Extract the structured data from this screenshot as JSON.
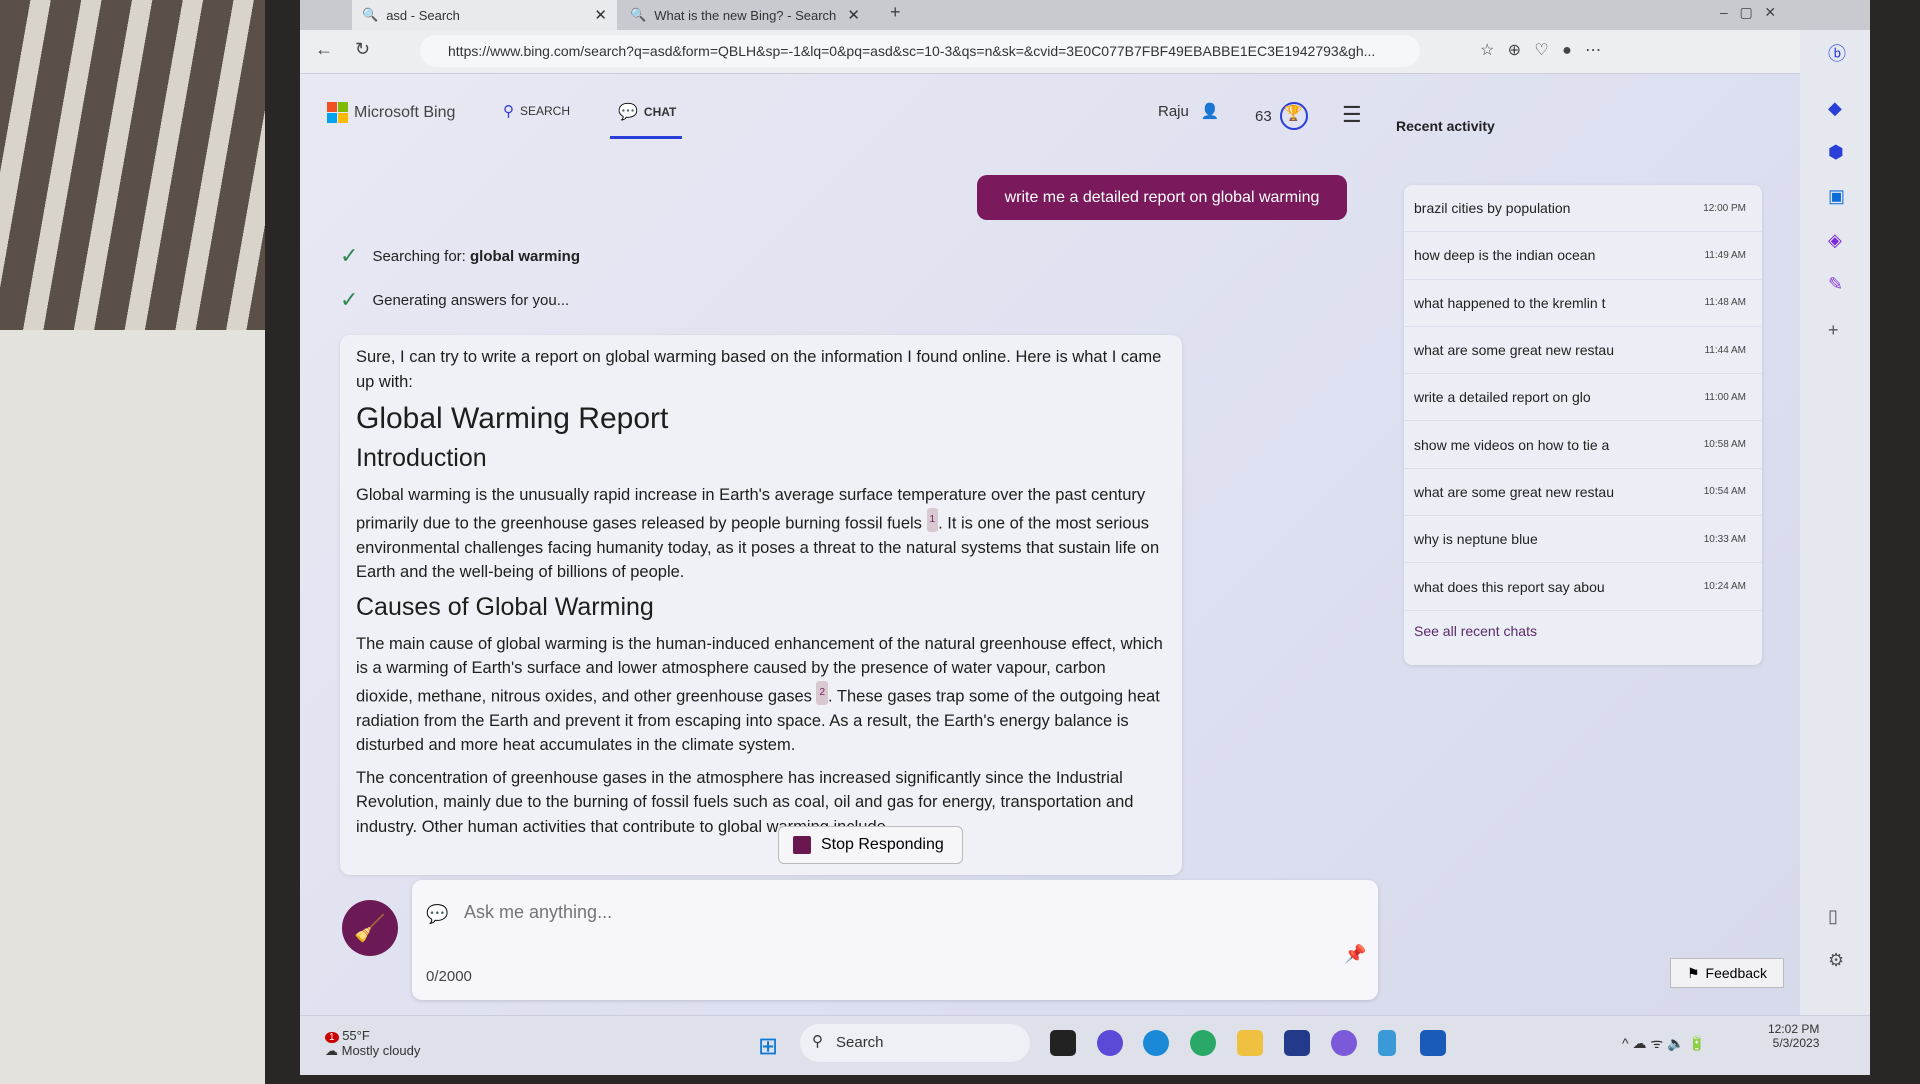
{
  "browser": {
    "tabs": [
      {
        "label": "asd - Search"
      },
      {
        "label": "What is the new Bing? - Search"
      }
    ],
    "url": "https://www.bing.com/search?q=asd&form=QBLH&sp=-1&lq=0&pq=asd&sc=10-3&qs=n&sk=&cvid=3E0C077B7FBF49EBABBE1EC3E1942793&gh..."
  },
  "header": {
    "brand": "Microsoft Bing",
    "nav": [
      {
        "label": "SEARCH"
      },
      {
        "label": "CHAT"
      }
    ],
    "user": "Raju",
    "points": "63",
    "recent_title": "Recent activity"
  },
  "chat": {
    "user_message": "write me a detailed report on global warming",
    "status": [
      {
        "prefix": "Searching for: ",
        "bold": "global warming"
      },
      {
        "prefix": "Generating answers for you...",
        "bold": ""
      }
    ],
    "answer": {
      "intro": "Sure, I can try to write a report on global warming based on the information I found online. Here is what I came up with:",
      "title": "Global Warming Report",
      "h_intro": "Introduction",
      "p1a": "Global warming is the unusually rapid increase in Earth's average surface temperature over the past century primarily due to the greenhouse gases released by people burning fossil fuels",
      "c1": "1",
      "p1b": ". It is one of the most serious environmental challenges facing humanity today, as it poses a threat to the natural systems that sustain life on Earth and the well-being of billions of people.",
      "h_causes": "Causes of Global Warming",
      "p2a": "The main cause of global warming is the human-induced enhancement of the natural greenhouse effect, which is a warming of Earth's surface and lower atmosphere caused by the presence of water vapour, carbon dioxide, methane, nitrous oxides, and other greenhouse gases",
      "c2": "2",
      "p2b": ". These gases trap some of the outgoing heat radiation from the Earth and prevent it from escaping into space. As a result, the Earth's energy balance is disturbed and more heat accumulates in the climate system.",
      "p3": "The concentration of greenhouse gases in the atmosphere has increased significantly since the Industrial Revolution, mainly due to the burning of fossil fuels such as coal, oil and gas for energy, transportation and industry. Other human activities that contribute to global warming include"
    },
    "stop_label": "Stop Responding",
    "input_placeholder": "Ask me anything...",
    "char_count": "0/2000"
  },
  "recent": {
    "items": [
      {
        "label": "brazil cities by population",
        "time": "12:00 PM"
      },
      {
        "label": "how deep is the indian ocean",
        "time": "11:49 AM"
      },
      {
        "label": "what happened to the kremlin t",
        "time": "11:48 AM"
      },
      {
        "label": "what are some great new restau",
        "time": "11:44 AM"
      },
      {
        "label": "write a detailed report on glo",
        "time": "11:00 AM"
      },
      {
        "label": "show me videos on how to tie a",
        "time": "10:58 AM"
      },
      {
        "label": "what are some great new restau",
        "time": "10:54 AM"
      },
      {
        "label": "why is neptune blue",
        "time": "10:33 AM"
      },
      {
        "label": "what does this report say abou",
        "time": "10:24 AM"
      }
    ],
    "see_all": "See all recent chats"
  },
  "feedback": "Feedback",
  "taskbar": {
    "weather_temp": "55°F",
    "weather_desc": "Mostly cloudy",
    "weather_badge": "1",
    "search": "Search",
    "time": "12:02 PM",
    "date": "5/3/2023"
  },
  "colors": {
    "accent": "#7a1a5c",
    "chat_underline": "#2a3fd8"
  }
}
